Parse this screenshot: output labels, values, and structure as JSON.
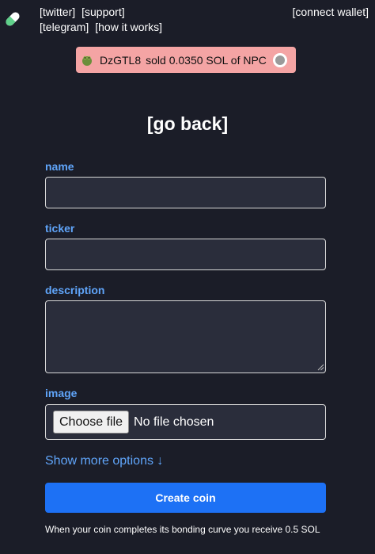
{
  "header": {
    "links_row1": [
      "[twitter]",
      "[support]"
    ],
    "links_row2": [
      "[telegram]",
      "[how it works]"
    ],
    "connect_wallet": "[connect wallet]"
  },
  "ticker": {
    "user": "DzGTL8",
    "message": "sold 0.0350 SOL of NPC"
  },
  "go_back": "[go back]",
  "form": {
    "name_label": "name",
    "ticker_label": "ticker",
    "description_label": "description",
    "image_label": "image",
    "choose_file": "Choose file",
    "no_file": "No file chosen",
    "show_more": "Show more options ↓",
    "create_button": "Create coin",
    "footnote": "When your coin completes its bonding curve you receive 0.5 SOL"
  },
  "colors": {
    "background": "#1b1d28",
    "accent_blue": "#60a5fa",
    "button_blue": "#1d71f5",
    "ticker_pink": "#f4a4a4"
  },
  "icons": [
    "pill-logo-icon",
    "frog-avatar-icon",
    "coin-avatar-icon"
  ]
}
